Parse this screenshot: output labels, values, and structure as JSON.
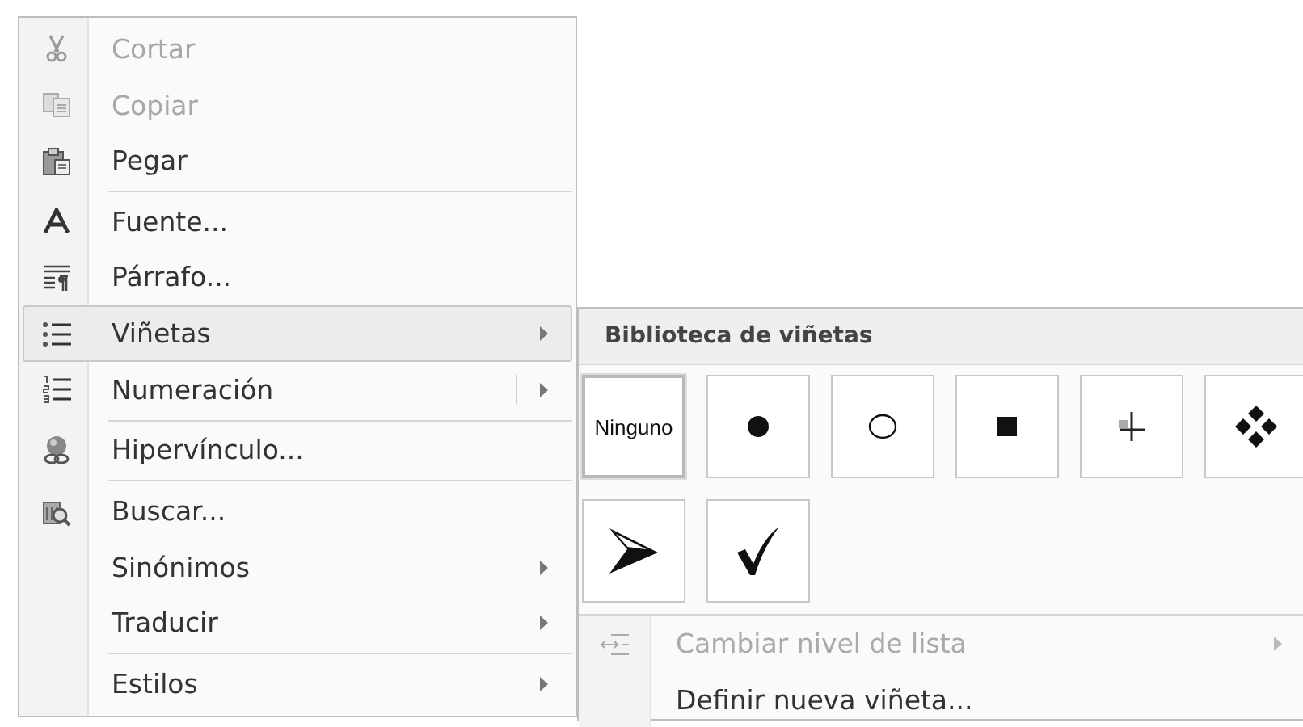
{
  "menu": {
    "items": [
      {
        "label": "Cortar",
        "disabled": true,
        "submenu": false,
        "split": false,
        "selected": false,
        "separator_after": false
      },
      {
        "label": "Copiar",
        "disabled": true,
        "submenu": false,
        "split": false,
        "selected": false,
        "separator_after": false
      },
      {
        "label": "Pegar",
        "disabled": false,
        "submenu": false,
        "split": false,
        "selected": false,
        "separator_after": true
      },
      {
        "label": "Fuente...",
        "disabled": false,
        "submenu": false,
        "split": false,
        "selected": false,
        "separator_after": false
      },
      {
        "label": "Párrafo...",
        "disabled": false,
        "submenu": false,
        "split": false,
        "selected": false,
        "separator_after": false
      },
      {
        "label": "Viñetas",
        "disabled": false,
        "submenu": true,
        "split": false,
        "selected": true,
        "separator_after": false
      },
      {
        "label": "Numeración",
        "disabled": false,
        "submenu": true,
        "split": true,
        "selected": false,
        "separator_after": true
      },
      {
        "label": "Hipervínculo...",
        "disabled": false,
        "submenu": false,
        "split": false,
        "selected": false,
        "separator_after": true
      },
      {
        "label": "Buscar...",
        "disabled": false,
        "submenu": false,
        "split": false,
        "selected": false,
        "separator_after": false
      },
      {
        "label": "Sinónimos",
        "disabled": false,
        "submenu": true,
        "split": false,
        "selected": false,
        "separator_after": false
      },
      {
        "label": "Traducir",
        "disabled": false,
        "submenu": true,
        "split": false,
        "selected": false,
        "separator_after": true
      },
      {
        "label": "Estilos",
        "disabled": false,
        "submenu": true,
        "split": false,
        "selected": false,
        "separator_after": false
      }
    ]
  },
  "submenu": {
    "header": "Biblioteca de viñetas",
    "bullets": [
      {
        "kind": "text",
        "label": "Ninguno",
        "selected": true
      },
      {
        "kind": "dot",
        "selected": false
      },
      {
        "kind": "circle",
        "selected": false
      },
      {
        "kind": "square",
        "selected": false
      },
      {
        "kind": "cross",
        "selected": false
      },
      {
        "kind": "diamonds",
        "selected": false
      },
      {
        "kind": "arrow",
        "selected": false
      },
      {
        "kind": "check",
        "selected": false
      }
    ],
    "items": [
      {
        "label": "Cambiar nivel de lista",
        "disabled": true,
        "submenu": true
      },
      {
        "label": "Definir nueva viñeta...",
        "disabled": false,
        "submenu": false
      }
    ]
  }
}
